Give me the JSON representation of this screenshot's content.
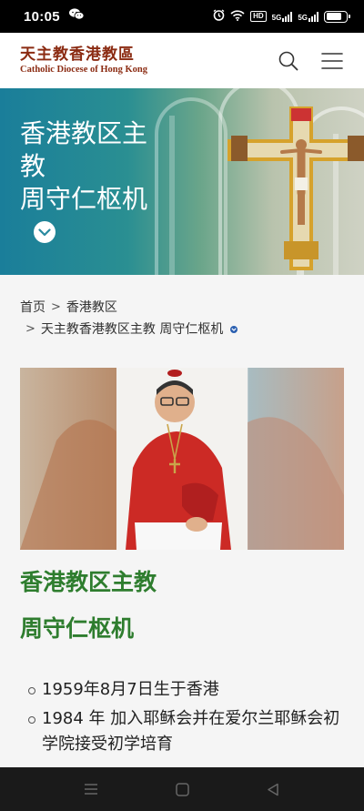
{
  "status_bar": {
    "time": "10:05",
    "hd_label": "HD",
    "sim1_label": "5G",
    "sim2_label": "5G",
    "battery_level": 0.8
  },
  "header": {
    "logo_cn": "天主教香港教區",
    "logo_en": "Catholic Diocese of Hong Kong"
  },
  "hero": {
    "title_line1": "香港教区主",
    "title_line2": "教",
    "title_line3": "周守仁枢机"
  },
  "breadcrumb": {
    "items": [
      "首页",
      "香港教区"
    ],
    "current": "天主教香港教区主教 周守仁枢机"
  },
  "article": {
    "title_line1": "香港教区主教",
    "title_line2": "周守仁枢机",
    "bio": [
      "1959年8月7日生于香港",
      "1984 年 加入耶稣会并在爱尔兰耶稣会初学院接受初学培育"
    ]
  },
  "colors": {
    "brand": "#8b2b12",
    "title_green": "#2e7d2e",
    "hero_teal": "#1a7e9a"
  }
}
